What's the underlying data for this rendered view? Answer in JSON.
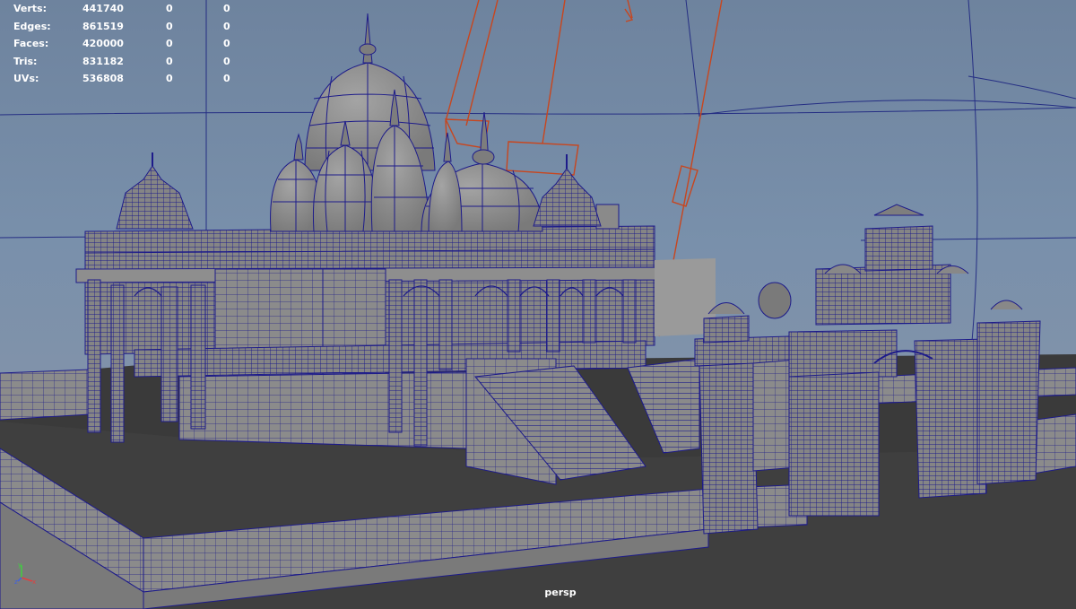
{
  "hud": {
    "rows": [
      {
        "label": "Verts:",
        "values": [
          "441740",
          "0",
          "0"
        ]
      },
      {
        "label": "Edges:",
        "values": [
          "861519",
          "0",
          "0"
        ]
      },
      {
        "label": "Faces:",
        "values": [
          "420000",
          "0",
          "0"
        ]
      },
      {
        "label": "Tris:",
        "values": [
          "831182",
          "0",
          "0"
        ]
      },
      {
        "label": "UVs:",
        "values": [
          "536808",
          "0",
          "0"
        ]
      }
    ]
  },
  "viewport": {
    "camera": "persp",
    "axis_gizmo": {
      "x": "x",
      "y": "y",
      "z": "z"
    }
  },
  "colors": {
    "wire": "#1d1b8a",
    "mesh": "#8c8c8c",
    "floor": "#3c3c3c",
    "camera_wire": "#c8461e",
    "background_top": "#6e839e",
    "background_bottom": "#8a98a8"
  },
  "icons": [
    "axis-gizmo-icon",
    "camera-frustum-icon"
  ]
}
